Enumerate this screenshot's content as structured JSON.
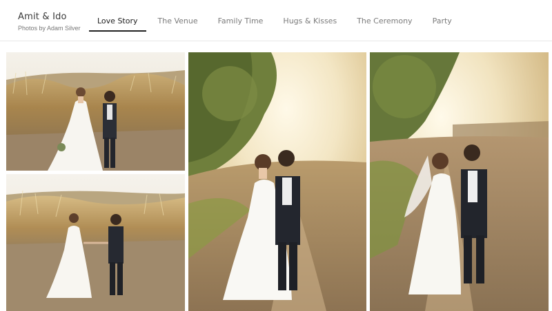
{
  "site": {
    "title": "Amit & Ido",
    "subtitle": "Photos by Adam Silver"
  },
  "nav": {
    "tabs": [
      {
        "label": "Love Story",
        "active": true
      },
      {
        "label": "The Venue",
        "active": false
      },
      {
        "label": "Family Time",
        "active": false
      },
      {
        "label": "Hugs & Kisses",
        "active": false
      },
      {
        "label": "The Ceremony",
        "active": false
      },
      {
        "label": "Party",
        "active": false
      }
    ]
  },
  "gallery": {
    "photos": [
      {
        "subject": "couple walking in tall golden grass, bride in off-shoulder white gown holding bouquet"
      },
      {
        "subject": "couple holding hands walking through pampas grass field"
      },
      {
        "subject": "couple embracing on dirt path under tree at sunset"
      },
      {
        "subject": "couple walking on dirt path with tree and sunlight, bride with veil"
      }
    ]
  },
  "colors": {
    "accent": "#222222",
    "tab_inactive": "#7a7a7a",
    "divider": "#e6e6e6"
  }
}
